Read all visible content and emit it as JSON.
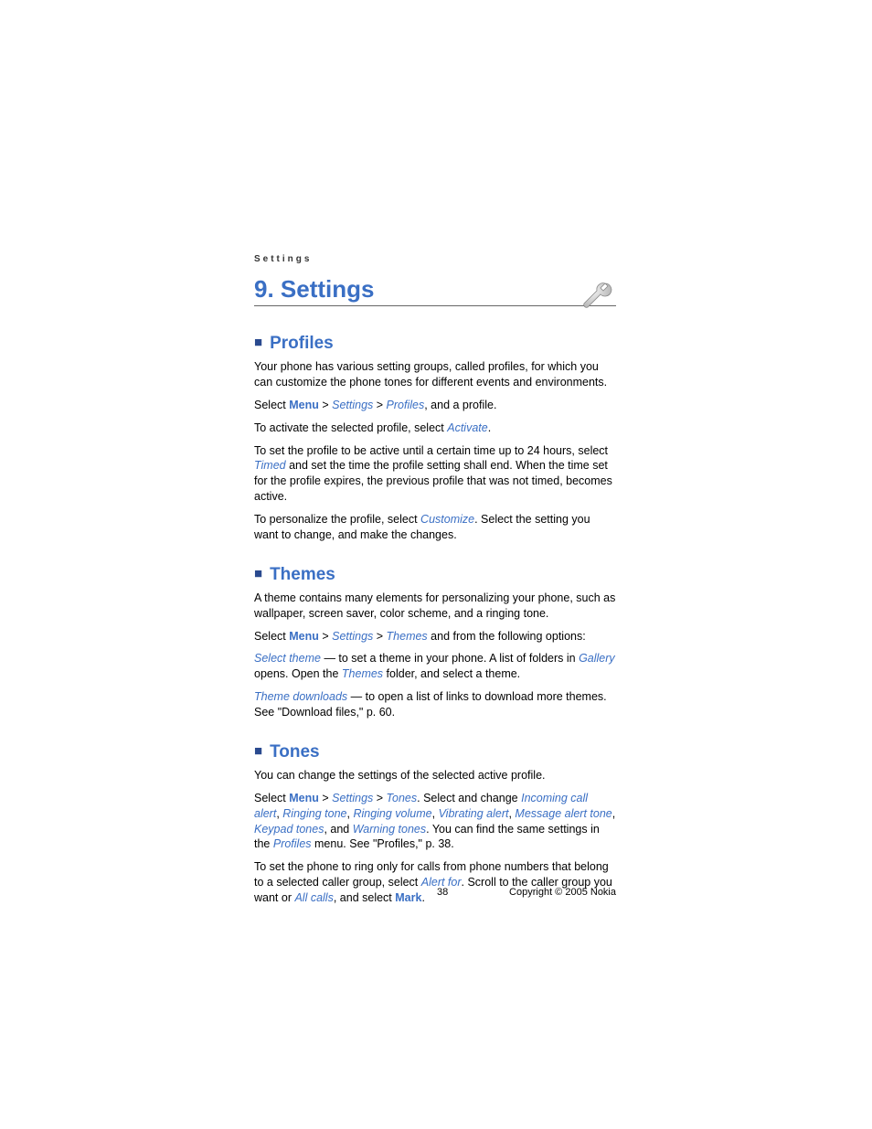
{
  "header": {
    "label": "Settings"
  },
  "chapter": {
    "title": "9.   Settings"
  },
  "sections": {
    "profiles": {
      "title": "Profiles",
      "p1": "Your phone has various setting groups, called profiles, for which you can customize the phone tones for different events and environments.",
      "p2a": "Select ",
      "p2menu": "Menu",
      "p2gt1": " > ",
      "p2settings": "Settings",
      "p2gt2": " > ",
      "p2profiles": "Profiles",
      "p2b": ", and a profile.",
      "p3a": "To activate the selected profile, select ",
      "p3activate": "Activate",
      "p3b": ".",
      "p4a": "To set the profile to be active until a certain time up to 24 hours, select ",
      "p4timed": "Timed",
      "p4b": " and set the time the profile setting shall end. When the time set for the profile expires, the previous profile that was not timed, becomes active.",
      "p5a": "To personalize the profile, select ",
      "p5customize": "Customize",
      "p5b": ". Select the setting you want to change, and make the changes."
    },
    "themes": {
      "title": "Themes",
      "p1": "A theme contains many elements for personalizing your phone, such as wallpaper, screen saver, color scheme, and a ringing tone.",
      "p2a": "Select ",
      "p2menu": "Menu",
      "p2gt1": " > ",
      "p2settings": "Settings",
      "p2gt2": " > ",
      "p2themes": "Themes",
      "p2b": " and from the following options:",
      "p3sel": "Select theme",
      "p3a": " — to set a theme in your phone. A list of folders in ",
      "p3gallery": "Gallery",
      "p3b": " opens. Open the ",
      "p3themes": "Themes",
      "p3c": " folder, and select a theme.",
      "p4dl": "Theme downloads",
      "p4a": " — to open a list of links to download more themes. See \"Download files,\" p. 60."
    },
    "tones": {
      "title": "Tones",
      "p1": "You can change the settings of the selected active profile.",
      "p2a": "Select ",
      "p2menu": "Menu",
      "p2gt1": " > ",
      "p2settings": "Settings",
      "p2gt2": " > ",
      "p2tones": "Tones",
      "p2b": ". Select and change ",
      "p2incoming": "Incoming call alert",
      "p2c1": ", ",
      "p2ringtone": "Ringing tone",
      "p2c2": ", ",
      "p2ringvol": "Ringing volume",
      "p2c3": ", ",
      "p2vibrate": "Vibrating alert",
      "p2c4": ", ",
      "p2msg": "Message alert tone",
      "p2c5": ", ",
      "p2keypad": "Keypad tones",
      "p2c6": ", and ",
      "p2warn": "Warning tones",
      "p2d": ". You can find the same settings in the ",
      "p2profiles": "Profiles",
      "p2e": " menu. See \"Profiles,\" p. 38.",
      "p3a": "To set the phone to ring only for calls from phone numbers that belong to a selected caller group, select ",
      "p3alert": "Alert for",
      "p3b": ". Scroll to the caller group you want or ",
      "p3all": "All calls",
      "p3c": ", and select ",
      "p3mark": "Mark",
      "p3d": "."
    }
  },
  "footer": {
    "page": "38",
    "copyright": "Copyright © 2005 Nokia"
  }
}
